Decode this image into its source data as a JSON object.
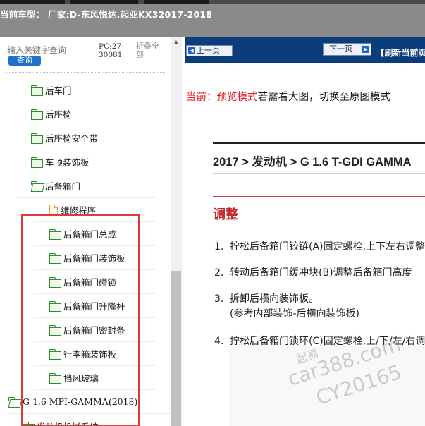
{
  "header": {
    "model_label": "当前车型：  厂家:D-东风悦达.起亚KX32017-2018"
  },
  "search": {
    "placeholder": "输入关键字查询",
    "button_label": "查询",
    "pc_range": "PC:27-30081",
    "collapse_all": "折叠全部"
  },
  "tree": {
    "items": [
      {
        "label": "后车门",
        "type": "folder"
      },
      {
        "label": "后座椅",
        "type": "folder"
      },
      {
        "label": "后座椅安全带",
        "type": "folder"
      },
      {
        "label": "车顶装饰板",
        "type": "folder"
      },
      {
        "label": "后备箱门",
        "type": "folder-open"
      },
      {
        "label": "维修程序",
        "type": "doc"
      },
      {
        "label": "后备箱门总成",
        "type": "folder"
      },
      {
        "label": "后备箱门装饰板",
        "type": "folder"
      },
      {
        "label": "后备箱门碰锁",
        "type": "folder"
      },
      {
        "label": "后备箱门升降杆",
        "type": "folder"
      },
      {
        "label": "后备箱门密封条",
        "type": "folder"
      },
      {
        "label": "行李箱装饰板",
        "type": "folder"
      },
      {
        "label": "挡风玻璃",
        "type": "folder"
      },
      {
        "label": "G 1.6 MPI-GAMMA(2018)",
        "type": "folder-open"
      },
      {
        "label": "发动机机械系统",
        "type": "folder"
      }
    ]
  },
  "nav": {
    "prev_label": "上一页",
    "next_label": "下一页",
    "refresh_label": "[刷新当前页]"
  },
  "content": {
    "preview_prefix": "当前：预览模式",
    "preview_suffix": "若需看大图，切换至原图模式",
    "breadcrumb": "2017 > 发动机 > G 1.6 T-GDI GAMMA",
    "section_heading": "调整",
    "steps": [
      {
        "num": "1.",
        "text": "拧松后备箱门铰链(A)固定螺栓,上下左右调整"
      },
      {
        "num": "2.",
        "text": "转动后备箱门缓冲块(B)调整后备箱门高度"
      },
      {
        "num": "3.",
        "text": "拆卸后横向装饰板。",
        "sub": "(参考内部装饰-后横向装饰板)"
      },
      {
        "num": "4.",
        "text": "拧松后备箱门锁环(C)固定螺栓,上/下/左/右调整"
      }
    ]
  },
  "watermark": {
    "line1": "起易",
    "line2": "car388.com",
    "line3": "CY20165"
  },
  "colors": {
    "header_bg": "#8a8a8a",
    "nav_bg": "#0c3d7a",
    "accent_red": "#e0202a",
    "folder_green": "#2e8b2e",
    "button_blue": "#1e73c8"
  }
}
